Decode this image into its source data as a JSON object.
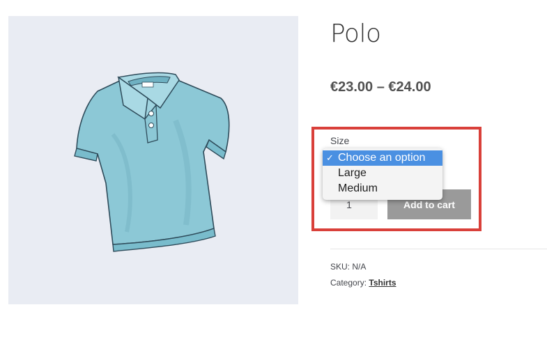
{
  "product": {
    "title": "Polo",
    "price_range": "€23.00 – €24.00",
    "image_icon": "polo-shirt-illustration",
    "shirt_color": "#8cc8d6",
    "image_bg": "#e9ecf3"
  },
  "variation": {
    "label": "Size",
    "options": [
      {
        "label": "Choose an option",
        "selected": true
      },
      {
        "label": "Large",
        "selected": false
      },
      {
        "label": "Medium",
        "selected": false
      }
    ],
    "check_glyph": "✓"
  },
  "cart": {
    "quantity": "1",
    "add_to_cart_label": "Add to cart"
  },
  "meta": {
    "sku_label": "SKU:",
    "sku_value": "N/A",
    "category_label": "Category:",
    "category_value": "Tshirts"
  },
  "colors": {
    "highlight": "#d9403a",
    "selected_option": "#4a90e2",
    "button_disabled": "#9a9a9a"
  }
}
